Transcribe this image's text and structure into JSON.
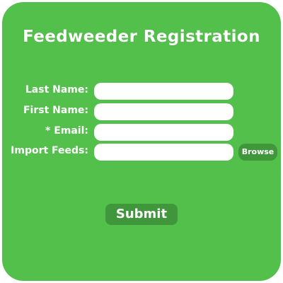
{
  "form": {
    "title": "Feedweeder Registration",
    "fields": [
      {
        "label": "Last Name:",
        "value": "",
        "placeholder": ""
      },
      {
        "label": "First Name:",
        "value": "",
        "placeholder": ""
      },
      {
        "label": "* Email:",
        "value": "",
        "placeholder": ""
      },
      {
        "label": "Import Feeds:",
        "value": "",
        "placeholder": ""
      }
    ],
    "browse_label": "Browse",
    "submit_label": "Submit"
  },
  "colors": {
    "card_background": "#52c04b",
    "button_background": "#3f963b",
    "text": "#ffffff",
    "field_background": "#ffffff"
  }
}
